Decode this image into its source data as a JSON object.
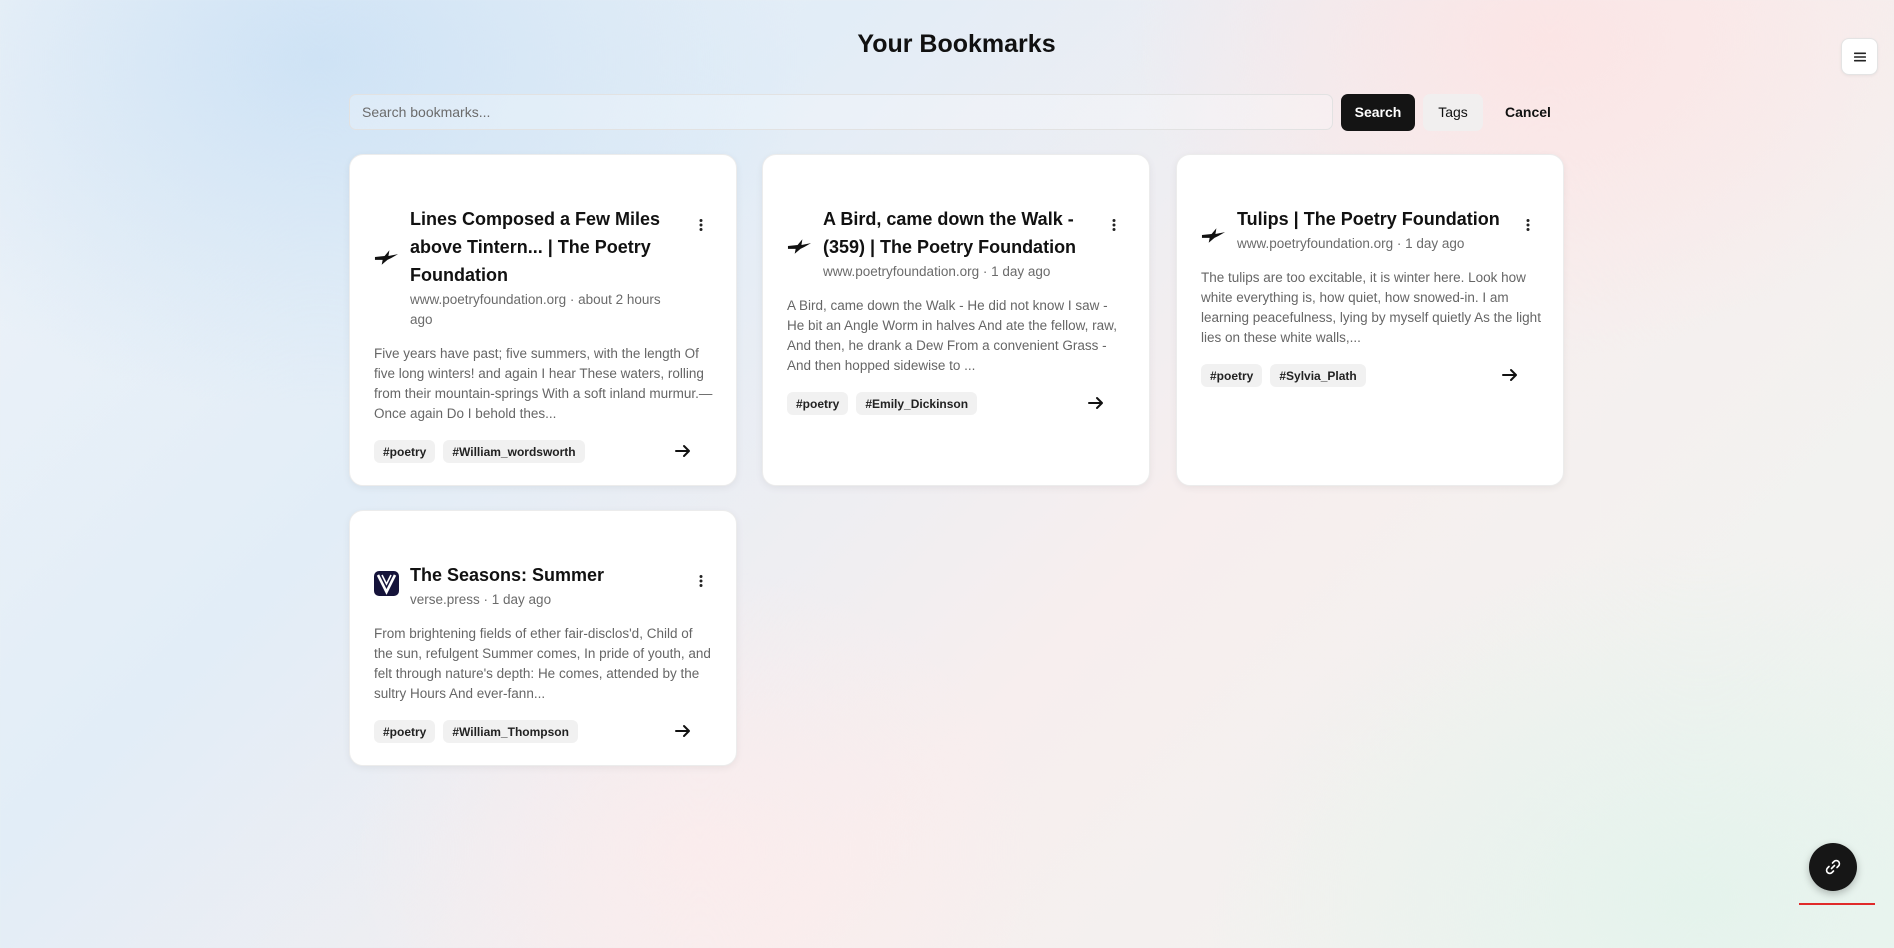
{
  "header": {
    "title": "Your Bookmarks",
    "menu_icon": "hamburger-menu-icon"
  },
  "search": {
    "placeholder": "Search bookmarks...",
    "value": "",
    "search_label": "Search",
    "tags_label": "Tags",
    "cancel_label": "Cancel"
  },
  "bookmarks": [
    {
      "title": "Lines Composed a Few Miles above Tintern... | The Poetry Foundation",
      "meta": "www.poetryfoundation.org · about 2 hours ago",
      "favicon": "poetry-foundation-bird-icon",
      "description": "Five years have past; five summers, with the length Of five long winters! and again I hear These waters, rolling from their mountain-springs With a soft inland murmur.—Once again Do I behold thes...",
      "tags": [
        "#poetry",
        "#William_wordsworth"
      ]
    },
    {
      "title": "A Bird, came down the Walk - (359) | The Poetry Foundation",
      "meta": "www.poetryfoundation.org · 1 day ago",
      "favicon": "poetry-foundation-bird-icon",
      "description": "A Bird, came down the Walk - He did not know I saw - He bit an Angle Worm in halves And ate the fellow, raw, And then, he drank a Dew From a convenient Grass - And then hopped sidewise to ...",
      "tags": [
        "#poetry",
        "#Emily_Dickinson"
      ]
    },
    {
      "title": "Tulips | The Poetry Foundation",
      "meta": "www.poetryfoundation.org · 1 day ago",
      "favicon": "poetry-foundation-bird-icon",
      "description": "The tulips are too excitable, it is winter here. Look how white everything is, how quiet, how snowed-in. I am learning peacefulness, lying by myself quietly As the light lies on these white walls,...",
      "tags": [
        "#poetry",
        "#Sylvia_Plath"
      ]
    },
    {
      "title": "The Seasons: Summer",
      "meta": "verse.press · 1 day ago",
      "favicon": "verse-press-logo-icon",
      "description": "From brightening fields of ether fair-disclos'd, Child of the sun, refulgent Summer comes, In pride of youth, and felt through nature's depth: He comes, attended by the sultry Hours And ever-fann...",
      "tags": [
        "#poetry",
        "#William_Thompson"
      ]
    }
  ],
  "fab": {
    "icon": "link-icon"
  },
  "colors": {
    "primary_button": "#141414",
    "fab": "#161616",
    "underline": "#e02a2a"
  }
}
